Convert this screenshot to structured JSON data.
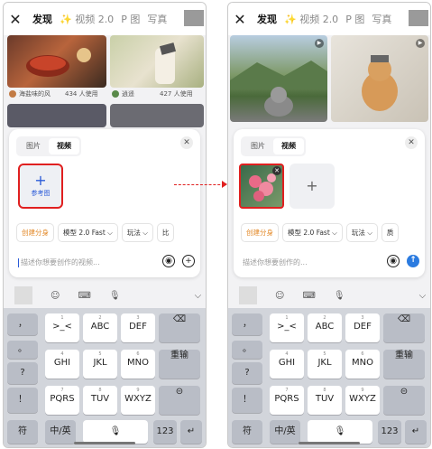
{
  "left": {
    "topbar": {
      "tabs": [
        "发现",
        "✨ 视频 2.0",
        "P 图",
        "写真"
      ]
    },
    "cards": [
      {
        "user": "海盐味的风",
        "uses": "434 人使用"
      },
      {
        "user": "逍遥",
        "uses": "427 人使用"
      }
    ],
    "panel": {
      "seg": [
        "图片",
        "视频"
      ],
      "ref_plus": "+",
      "ref_label": "参考图",
      "chips": [
        "创建分身",
        "模型 2.0 Fast ⌵",
        "玩法 ⌵",
        "比"
      ],
      "prompt_placeholder": "描述你想要创作的视频..."
    }
  },
  "right": {
    "topbar": {
      "tabs": [
        "发现",
        "✨ 视频 2.0",
        "P 图",
        "写真"
      ]
    },
    "panel": {
      "seg": [
        "图片",
        "视频"
      ],
      "add_plus": "+",
      "chips": [
        "创建分身",
        "模型 2.0 Fast ⌵",
        "玩法 ⌵",
        "质"
      ],
      "prompt_placeholder": "描述你想要创作的..."
    }
  },
  "keyboard": {
    "row1": [
      {
        "n": "",
        "t": "，"
      },
      {
        "n": "1",
        "t": ">_<"
      },
      {
        "n": "2",
        "t": "ABC"
      },
      {
        "n": "3",
        "t": "DEF"
      },
      {
        "n": "",
        "t": "⌫"
      }
    ],
    "row2": [
      {
        "n": "",
        "t": "。"
      },
      {
        "n": "4",
        "t": "GHI"
      },
      {
        "n": "5",
        "t": "JKL"
      },
      {
        "n": "6",
        "t": "MNO"
      },
      {
        "n": "",
        "t": "重输"
      }
    ],
    "q": "?",
    "row3": [
      {
        "n": "",
        "t": "！"
      },
      {
        "n": "7",
        "t": "PQRS"
      },
      {
        "n": "8",
        "t": "TUV"
      },
      {
        "n": "9",
        "t": "WXYZ"
      },
      {
        "n": "",
        "t": "⊝"
      }
    ],
    "bottom": {
      "fu": "符",
      "zh": "中/英",
      "num": "123",
      "enter": "↵"
    }
  },
  "colors": {
    "accent": "#2b5bd8",
    "highlight": "#e02020",
    "orange": "#e38a2a"
  }
}
